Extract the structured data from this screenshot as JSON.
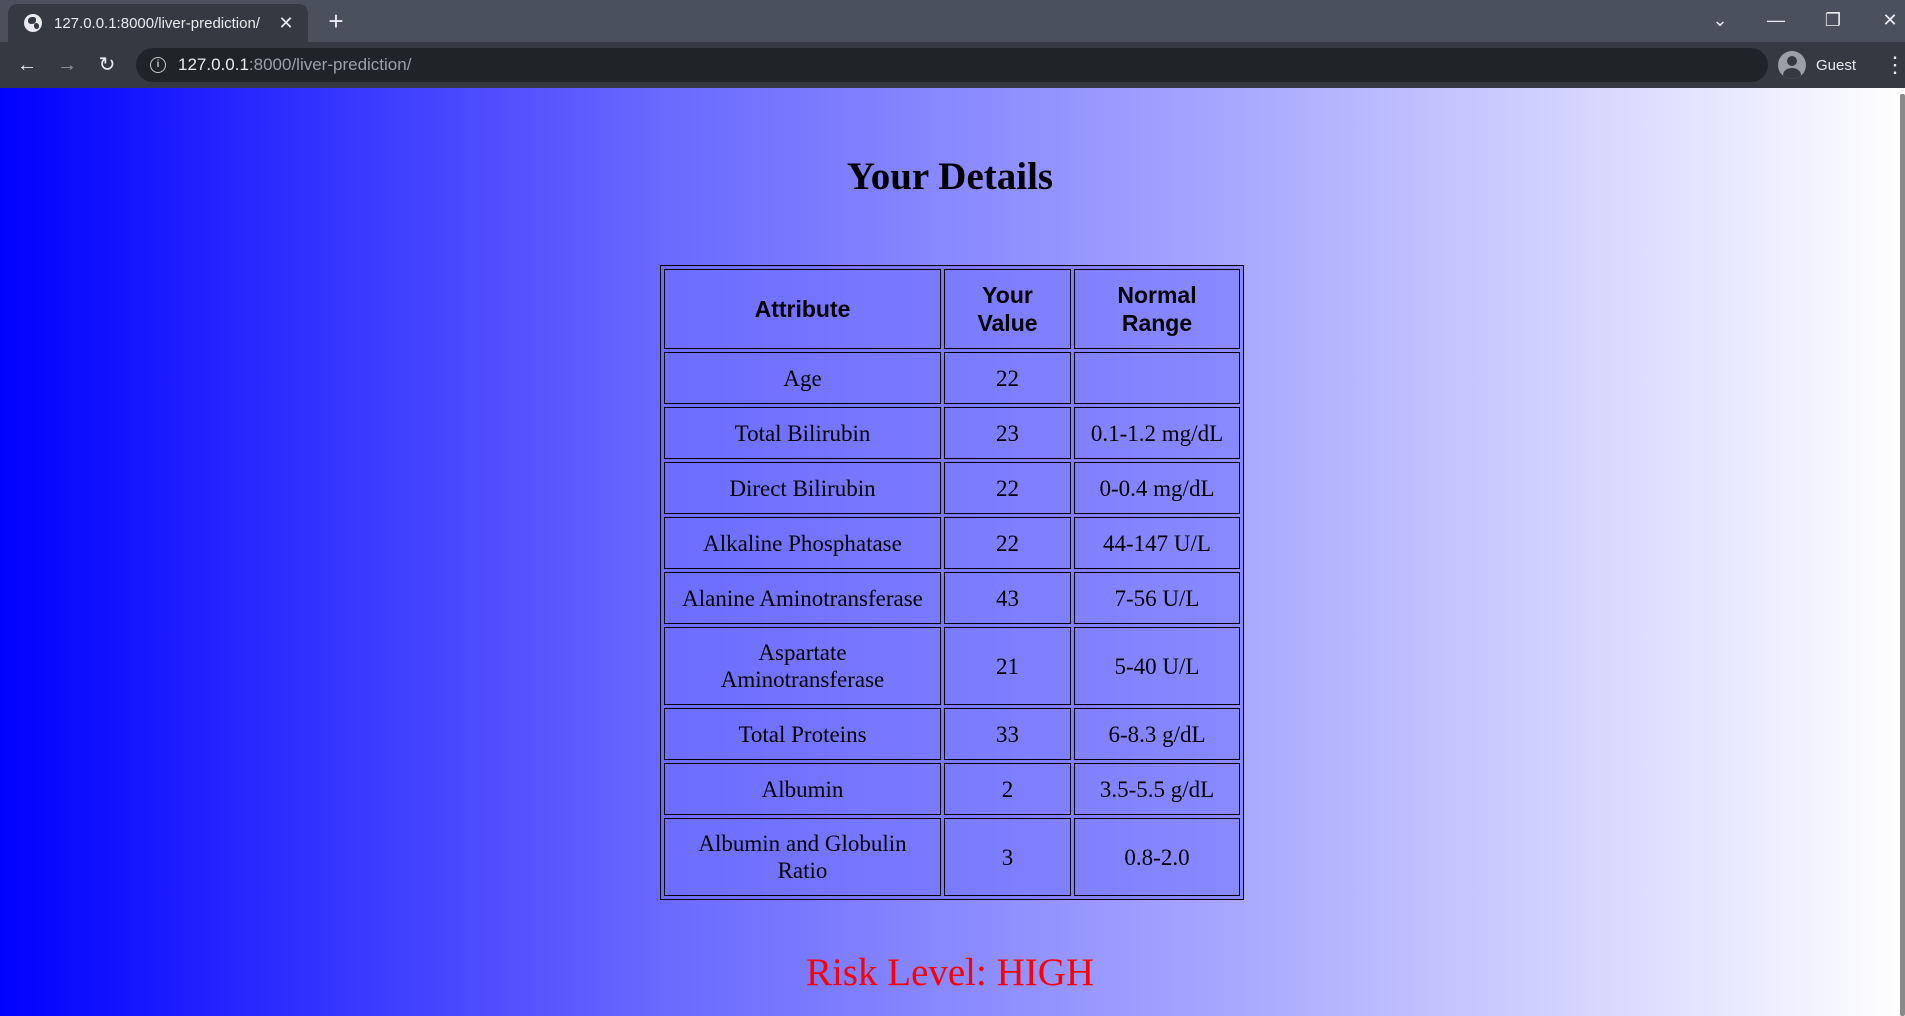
{
  "browser": {
    "tab_title": "127.0.0.1:8000/liver-prediction/",
    "tab_close": "✕",
    "new_tab": "+",
    "url_host": "127.0.0.1",
    "url_rest": ":8000/liver-prediction/",
    "profile_name": "Guest",
    "back": "←",
    "forward": "→",
    "reload": "↻",
    "menu": "⋮",
    "tab_search": "⌄",
    "minimize": "—",
    "restore": "❐",
    "close": "✕"
  },
  "page": {
    "title": "Your Details",
    "table": {
      "headers": [
        "Attribute",
        "Your Value",
        "Normal Range"
      ],
      "rows": [
        {
          "attribute": "Age",
          "value": "22",
          "range": ""
        },
        {
          "attribute": "Total Bilirubin",
          "value": "23",
          "range": "0.1-1.2 mg/dL"
        },
        {
          "attribute": "Direct Bilirubin",
          "value": "22",
          "range": "0-0.4 mg/dL"
        },
        {
          "attribute": "Alkaline Phosphatase",
          "value": "22",
          "range": "44-147 U/L"
        },
        {
          "attribute": "Alanine Aminotransferase",
          "value": "43",
          "range": "7-56 U/L"
        },
        {
          "attribute": "Aspartate Aminotransferase",
          "value": "21",
          "range": "5-40 U/L"
        },
        {
          "attribute": "Total Proteins",
          "value": "33",
          "range": "6-8.3 g/dL"
        },
        {
          "attribute": "Albumin",
          "value": "2",
          "range": "3.5-5.5 g/dL"
        },
        {
          "attribute": "Albumin and Globulin Ratio",
          "value": "3",
          "range": "0.8-2.0"
        }
      ]
    },
    "risk_text": "Risk Level: HIGH",
    "colors": {
      "gradient_start": "#0000ff",
      "gradient_end": "#ffffff",
      "risk": "#ff0000"
    }
  }
}
